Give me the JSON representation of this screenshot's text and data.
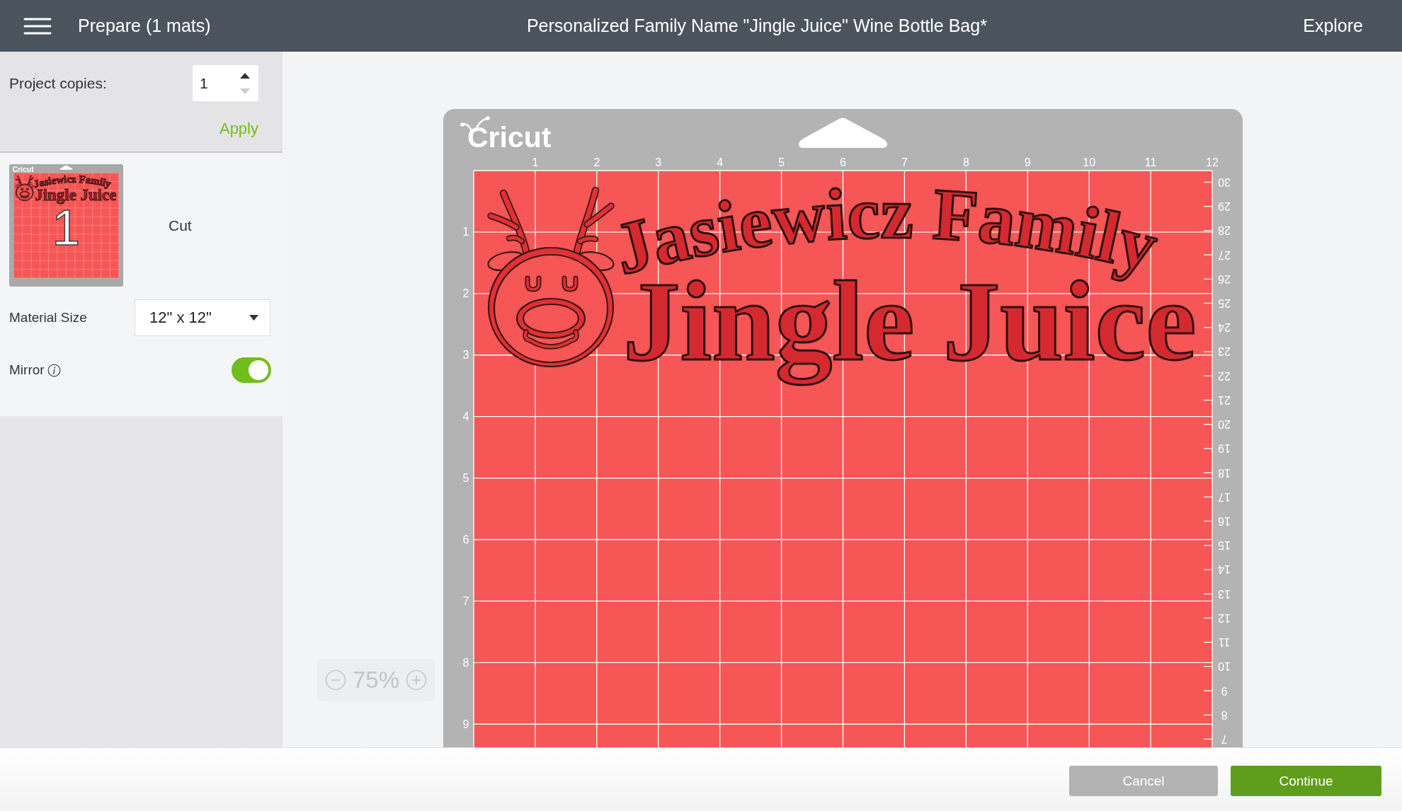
{
  "header": {
    "page_title": "Prepare (1 mats)",
    "project_title": "Personalized Family Name \"Jingle Juice\" Wine Bottle Bag*",
    "explore": "Explore"
  },
  "copies": {
    "label": "Project copies:",
    "value": "1",
    "increase_disabled": false,
    "decrease_disabled": true,
    "apply": "Apply"
  },
  "mats": [
    {
      "number": "1",
      "logo": "Cricut",
      "design_text": [
        "Jasiewicz Family",
        "Jingle Juice"
      ],
      "mode": "Cut",
      "material_size": {
        "label": "Material Size",
        "value": "12\" x 12\""
      },
      "mirror": {
        "label": "Mirror",
        "on": true
      }
    }
  ],
  "canvas_mat": {
    "logo": "Cricut",
    "top_ruler": [
      "1",
      "2",
      "3",
      "4",
      "5",
      "6",
      "7",
      "8",
      "9",
      "10",
      "11",
      "12"
    ],
    "left_ruler": [
      "1",
      "2",
      "3",
      "4",
      "5",
      "6",
      "7",
      "8",
      "9"
    ],
    "right_ruler": [
      "30",
      "29",
      "28",
      "27",
      "26",
      "25",
      "24",
      "23",
      "22",
      "21",
      "20",
      "19",
      "18",
      "17",
      "16",
      "15",
      "14",
      "13",
      "12",
      "11",
      "10",
      "9",
      "8",
      "7"
    ],
    "design_text": [
      "Jasiewicz Family",
      "Jingle Juice"
    ]
  },
  "zoom": {
    "value": "75%",
    "disabled": true
  },
  "footer": {
    "buttons": [
      {
        "label": "Cancel",
        "kind": "secondary"
      },
      {
        "label": "Continue",
        "kind": "primary"
      }
    ]
  }
}
